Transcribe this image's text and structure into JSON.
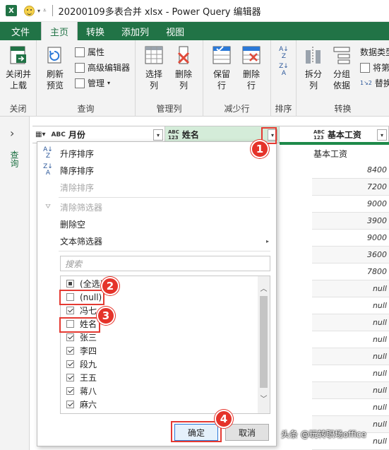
{
  "titlebar": {
    "logo": "X",
    "title": "20200109多表合并 xlsx - Power Query 编辑器"
  },
  "tabs": [
    "文件",
    "主页",
    "转换",
    "添加列",
    "视图"
  ],
  "ribbon": {
    "close": {
      "btn": "关闭并\n上载",
      "group": "关闭"
    },
    "query": {
      "refresh": "刷新\n预览",
      "properties": "属性",
      "advanced": "高级编辑器",
      "manage": "管理",
      "group": "查询"
    },
    "manage_cols": {
      "choose": "选择\n列",
      "remove": "删除\n列",
      "group": "管理列"
    },
    "reduce_rows": {
      "keep": "保留\n行",
      "remove": "删除\n行",
      "group": "减少行"
    },
    "sort": {
      "group": "排序"
    },
    "transform": {
      "split": "拆分\n列",
      "groupby": "分组\n依据",
      "datatype": "数据类型",
      "first_row": "将第",
      "replace": "替换",
      "group": "转换"
    }
  },
  "queries_strip": {
    "label": "查询"
  },
  "grid": {
    "columns": [
      {
        "type": "ABC",
        "name": "月份"
      },
      {
        "type": "ABC\n123",
        "name": "姓名"
      },
      {
        "type": "ABC\n123",
        "name": "基本工资"
      }
    ],
    "salary_col": [
      "基本工资",
      "8400",
      "7200",
      "9000",
      "3900",
      "9000",
      "3600",
      "7800",
      "null",
      "null",
      "null",
      "null",
      "null",
      "null",
      "null",
      "null",
      "null",
      "null",
      "null"
    ]
  },
  "menu": {
    "sort_asc": "升序排序",
    "sort_desc": "降序排序",
    "clear_sort": "清除排序",
    "clear_filter": "清除筛选器",
    "remove_empty": "删除空",
    "text_filters": "文本筛选器",
    "search_placeholder": "搜索",
    "items": [
      {
        "label": "(全选)",
        "state": "part"
      },
      {
        "label": "(null)",
        "state": "off"
      },
      {
        "label": "冯七",
        "state": "on"
      },
      {
        "label": "姓名",
        "state": "off"
      },
      {
        "label": "张三",
        "state": "on"
      },
      {
        "label": "李四",
        "state": "on"
      },
      {
        "label": "段九",
        "state": "on"
      },
      {
        "label": "王五",
        "state": "on"
      },
      {
        "label": "蒋八",
        "state": "on"
      },
      {
        "label": "麻六",
        "state": "on"
      }
    ],
    "ok": "确定",
    "cancel": "取消"
  },
  "callouts": [
    "1",
    "2",
    "3",
    "4"
  ],
  "watermark": "头条 @玩转职场office",
  "colors": {
    "excel_green": "#217346",
    "callout_red": "#e5332a",
    "selected_header": "#d4ecd9"
  }
}
